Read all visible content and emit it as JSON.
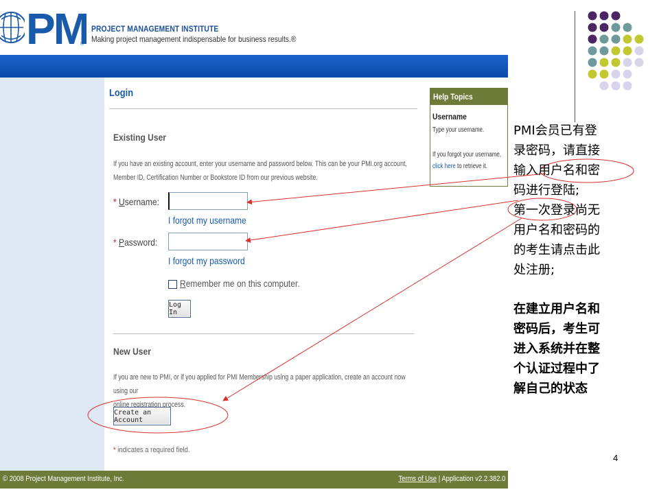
{
  "header": {
    "org_name": "PROJECT MANAGEMENT INSTITUTE",
    "tagline": "Making project management indispensable for business results.®"
  },
  "login": {
    "title": "Login",
    "existing": {
      "heading": "Existing User",
      "description_line1": "If you have an existing account, enter your username and password below. This can be your PMI.org account,",
      "description_line2": "Member ID, Certification Number or Bookstore ID from our previous website.",
      "username_label_first": "U",
      "username_label_rest": "sername:",
      "username_value": "",
      "forgot_username": "I forgot my username",
      "password_label_first": "P",
      "password_label_rest": "assword:",
      "password_value": "",
      "forgot_password": "I forgot my password",
      "remember_first": "R",
      "remember_rest": "emember me on this computer.",
      "login_button": "Log In"
    },
    "new_user": {
      "heading": "New User",
      "description_line1": "If you are new to PMI, or if you applied for PMI Membership using a paper application, create an account now using our",
      "description_line2": "online registration process.",
      "create_button": "Create an Account"
    },
    "required_mark": "*",
    "required_note": " indicates a required field."
  },
  "help": {
    "title": "Help Topics",
    "subtitle": "Username",
    "line1": "Type your username.",
    "line2": "If you forgot your username,",
    "link": "click here",
    "line3_rest": " to retrieve it."
  },
  "footer": {
    "copyright": "© 2008 Project Management Institute, Inc.",
    "terms": "Terms of Use",
    "separator": " | ",
    "application": "Application v2.2.382.0"
  },
  "annotations": {
    "note1_lines": [
      "PMI会员已有登",
      "录密码，请直接",
      "输入用户名和密",
      "码进行登陆;",
      "第一次登录尚无",
      "用户名和密码的",
      "的考生请点击此",
      "处注册;"
    ],
    "note2_lines": [
      "在建立用户名和",
      "密码后，考生可",
      "进入系统并在整",
      "个认证过程中了",
      "解自己的状态"
    ],
    "arrow_color": "#d9312b"
  },
  "slide_number": "4",
  "colors": {
    "header_blue": "#0a4aa8",
    "footer_green": "#6d7b39",
    "dots": [
      "#4b2464",
      "#6f9a9c",
      "#c2c830",
      "#d9d4ea"
    ]
  }
}
